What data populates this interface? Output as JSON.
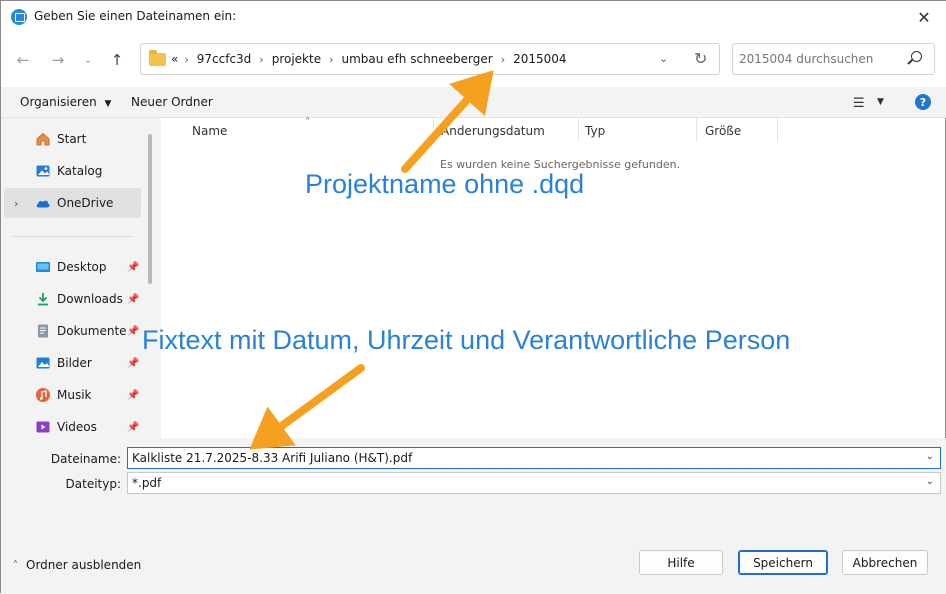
{
  "window": {
    "title": "Geben Sie einen Dateinamen ein:"
  },
  "nav": {
    "breadcrumb_overflow": "«",
    "breadcrumb": [
      "97ccfc3d",
      "projekte",
      "umbau efh schneeberger",
      "2015004"
    ],
    "search_placeholder": "2015004 durchsuchen"
  },
  "toolbar": {
    "organize_label": "Organisieren",
    "new_folder_label": "Neuer Ordner",
    "help_label": "?"
  },
  "sidebar": {
    "items": [
      {
        "label": "Start",
        "icon": "home-icon"
      },
      {
        "label": "Katalog",
        "icon": "gallery-icon"
      },
      {
        "label": "OneDrive",
        "icon": "onedrive-icon",
        "selected": true
      },
      {
        "label": "Desktop",
        "icon": "desktop-icon",
        "pinned": true
      },
      {
        "label": "Downloads",
        "icon": "download-icon",
        "pinned": true
      },
      {
        "label": "Dokumente",
        "icon": "documents-icon",
        "pinned": true
      },
      {
        "label": "Bilder",
        "icon": "pictures-icon",
        "pinned": true
      },
      {
        "label": "Musik",
        "icon": "music-icon",
        "pinned": true
      },
      {
        "label": "Videos",
        "icon": "videos-icon",
        "pinned": true
      }
    ]
  },
  "file_list": {
    "columns": [
      "Name",
      "Änderungsdatum",
      "Typ",
      "Größe"
    ],
    "empty_message": "Es wurden keine Suchergebnisse gefunden."
  },
  "annotations": {
    "project_note": "Projektname ohne .dqd",
    "fixtext_note": "Fixtext mit Datum, Uhrzeit und Verantwortliche Person",
    "arrow_color": "#f5a11f"
  },
  "form": {
    "filename_label": "Dateiname:",
    "filename_value": "Kalkliste 21.7.2025-8.33 Arifi Juliano (H&T).pdf",
    "filetype_label": "Dateityp:",
    "filetype_value": "*.pdf"
  },
  "footer": {
    "hide_folders_label": "Ordner ausblenden",
    "help_button": "Hilfe",
    "save_button": "Speichern",
    "cancel_button": "Abbrechen"
  },
  "colors": {
    "accent": "#1f6fd0",
    "annotation_text": "#2a82d6"
  }
}
